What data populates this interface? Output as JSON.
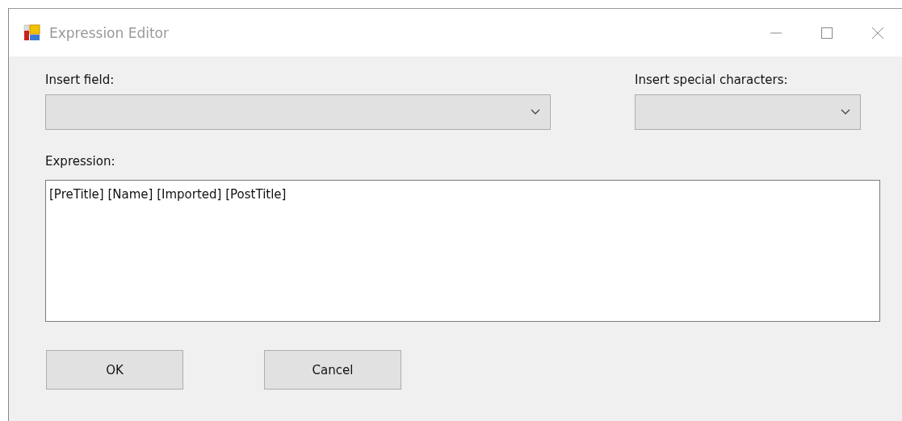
{
  "window": {
    "title": "Expression Editor"
  },
  "insert_field": {
    "label": "Insert field:"
  },
  "insert_special_characters": {
    "label": "Insert special characters:"
  },
  "expression": {
    "label": "Expression:",
    "value": "[PreTitle] [Name] [Imported] [PostTitle]"
  },
  "buttons": [
    "OK",
    "Cancel"
  ]
}
